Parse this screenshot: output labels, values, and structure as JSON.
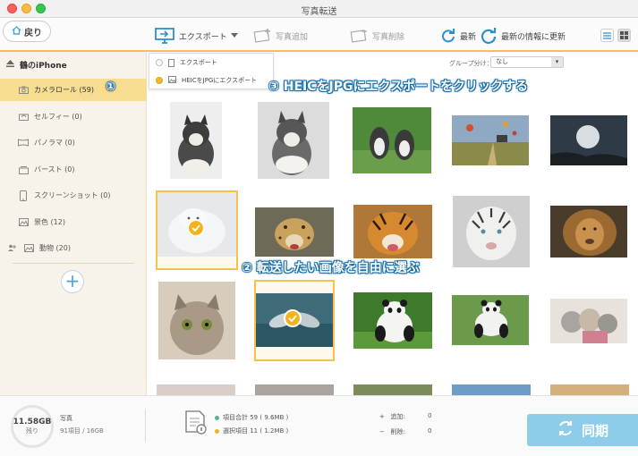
{
  "window": {
    "title": "写真転送"
  },
  "toolbar": {
    "back_label": "戻り",
    "export_label": "エクスポート",
    "add_label": "写真追加",
    "delete_label": "写真削除",
    "refresh_label": "最新",
    "update_label": "最新の情報に更新"
  },
  "export_menu": {
    "items": [
      "エクスポート",
      "HEICをJPGにエクスポート"
    ]
  },
  "sidebar": {
    "device": "鶴のiPhone",
    "items": [
      {
        "label": "カメラロール (59)",
        "icon": "camera-icon"
      },
      {
        "label": "セルフィー (0)",
        "icon": "selfie-icon"
      },
      {
        "label": "パノラマ (0)",
        "icon": "panorama-icon"
      },
      {
        "label": "バースト (0)",
        "icon": "burst-icon"
      },
      {
        "label": "スクリーンショット (0)",
        "icon": "phone-icon"
      },
      {
        "label": "景色 (12)",
        "icon": "landscape-icon"
      },
      {
        "label": "動物 (20)",
        "icon": "animal-icon"
      }
    ]
  },
  "content": {
    "group_label": "グループ分け：",
    "group_value": "なし",
    "photos": [
      "husky-puppy",
      "husky-puppy-snow",
      "huskies",
      "hot-air-balloons",
      "moon-night",
      "white-fox",
      "leopard",
      "tiger",
      "white-tiger",
      "lion",
      "kitten",
      "dolphins",
      "panda",
      "panda-grass",
      "kittens",
      "photo-16",
      "photo-17",
      "photo-18",
      "photo-19",
      "photo-20"
    ],
    "selected": [
      "white-fox",
      "dolphins"
    ]
  },
  "annotations": {
    "step1": "①",
    "step2": "② 転送したい画像を自由に選ぶ",
    "step3": "③ HEICをJPGにエクスポートをクリックする"
  },
  "footer": {
    "storage_free": "11.58GB",
    "storage_free_label": "残り",
    "category": "写真",
    "storage_detail": "91項目 / 16GB",
    "total_items": "項目合計 59 ( 9.6MB )",
    "selected_items": "選択項目 11 ( 1.2MB )",
    "add_label": "追加:",
    "add_count": "0",
    "delete_label": "削除:",
    "delete_count": "0",
    "sync_label": "同期"
  },
  "colors": {
    "accent": "#f2c14e",
    "sidebar_active": "#f7dd91",
    "sync_button": "#8dcdea",
    "callout_outline": "#1b6fa8"
  }
}
